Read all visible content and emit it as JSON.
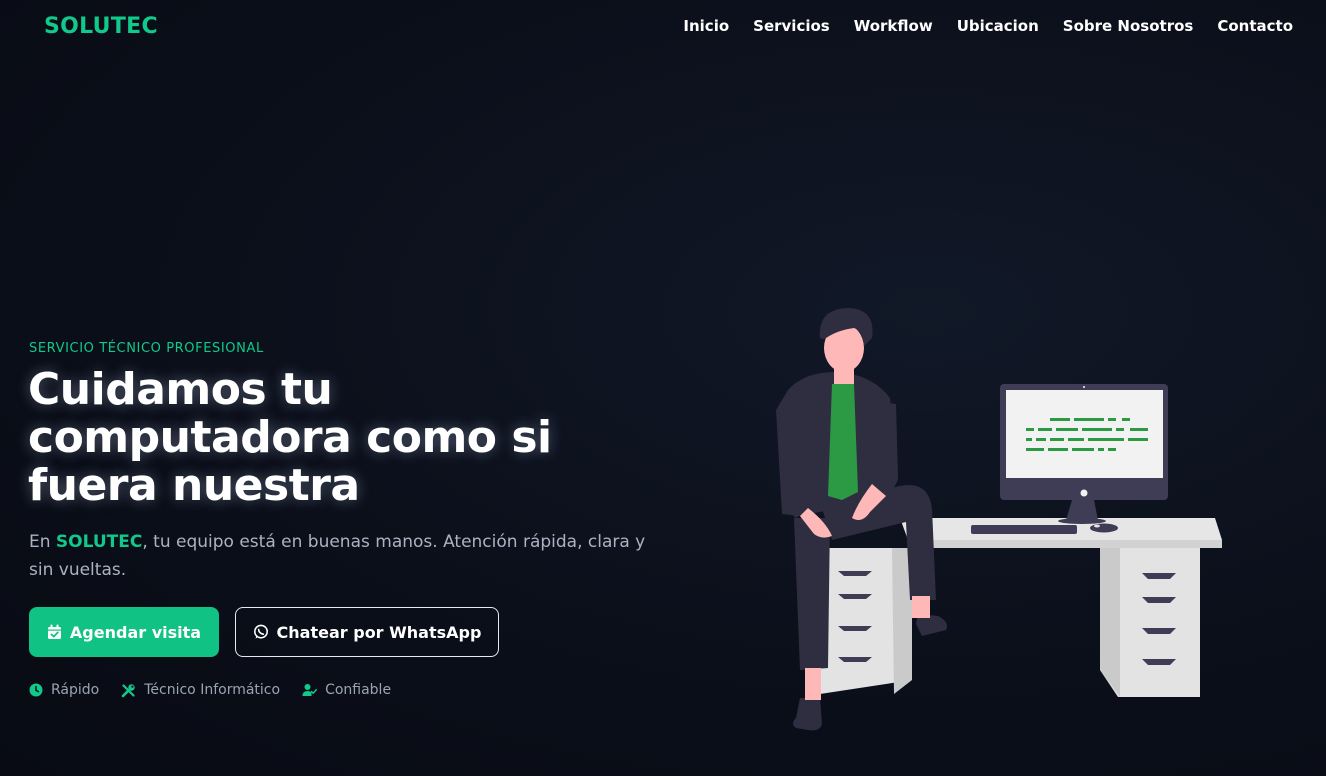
{
  "header": {
    "logo": "SOLUTEC",
    "nav": [
      "Inicio",
      "Servicios",
      "Workflow",
      "Ubicacion",
      "Sobre Nosotros",
      "Contacto"
    ]
  },
  "hero": {
    "eyebrow": "SERVICIO TÉCNICO PROFESIONAL",
    "headline_lines": [
      "Cuidamos tu",
      "computadora como si",
      "fuera nuestra"
    ],
    "subtext_prefix": "En ",
    "subtext_brand": "SOLUTEC",
    "subtext_rest": ", tu equipo está en buenas manos. Atención rápida, clara y sin vueltas.",
    "primary_button": "Agendar visita",
    "secondary_button": "Chatear por WhatsApp",
    "features": [
      "Rápido",
      "Técnico Informático",
      "Confiable"
    ]
  },
  "icons": {
    "primary_button_icon": "calendar-check-icon",
    "secondary_button_icon": "whatsapp-icon",
    "feature_icons": [
      "clock-icon",
      "tools-icon",
      "user-check-icon"
    ]
  },
  "colors": {
    "accent": "#10c98a",
    "button_bg": "#10c283",
    "background": "#0b101b"
  }
}
